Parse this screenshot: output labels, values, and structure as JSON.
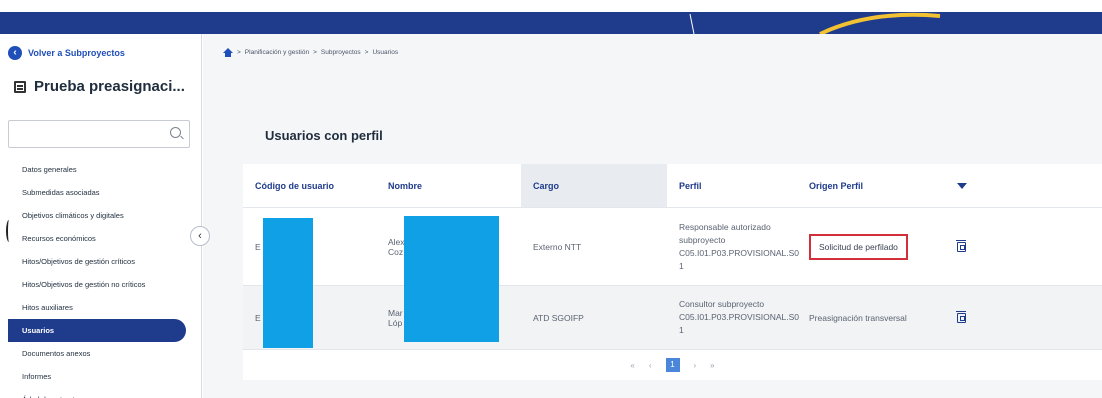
{
  "sidebar": {
    "back_label": "Volver a Subproyectos",
    "project_title": "Prueba preasignaci...",
    "search": {
      "placeholder": "",
      "value": ""
    },
    "items": [
      {
        "label": "Datos generales",
        "active": false
      },
      {
        "label": "Submedidas asociadas",
        "active": false
      },
      {
        "label": "Objetivos climáticos y digitales",
        "active": false
      },
      {
        "label": "Recursos económicos",
        "active": false
      },
      {
        "label": "Hitos/Objetivos de gestión críticos",
        "active": false
      },
      {
        "label": "Hitos/Objetivos de gestión no críticos",
        "active": false
      },
      {
        "label": "Hitos auxiliares",
        "active": false
      },
      {
        "label": "Usuarios",
        "active": true
      },
      {
        "label": "Documentos anexos",
        "active": false
      },
      {
        "label": "Informes",
        "active": false
      },
      {
        "label": "Árbol de estructura",
        "active": false
      }
    ],
    "collapse_icon": "‹"
  },
  "breadcrumb": {
    "sep": ">",
    "items": [
      "Planificación y gestión",
      "Subproyectos",
      "Usuarios"
    ]
  },
  "main": {
    "section_title": "Usuarios con perfil"
  },
  "table": {
    "headers": {
      "codigo": "Código de usuario",
      "nombre": "Nombre",
      "cargo": "Cargo",
      "perfil": "Perfil",
      "origen": "Origen Perfil"
    },
    "rows": [
      {
        "codigo": "E",
        "nombre_l1": "Alex",
        "nombre_l2": "Coz",
        "cargo": "Externo NTT",
        "perfil_l1": "Responsable autorizado",
        "perfil_l2": "subproyecto",
        "perfil_l3": "C05.I01.P03.PROVISIONAL.S0",
        "perfil_l4": "1",
        "origen": "Solicitud de perfilado"
      },
      {
        "codigo": "E",
        "nombre_l1": "Mar",
        "nombre_l2": "Lóp",
        "cargo": "ATD SGOIFP",
        "perfil_l1": "Consultor subproyecto",
        "perfil_l2": "C05.I01.P03.PROVISIONAL.S0",
        "perfil_l3": "1",
        "origen": "Preasignación transversal"
      }
    ]
  },
  "pagination": {
    "first": "«",
    "prev": "‹",
    "current": "1",
    "next": "›",
    "last": "»"
  },
  "colors": {
    "brand": "#1f3b8c",
    "link": "#1f4fb8",
    "redaction": "#0fa0e6",
    "highlight_border": "#d32f3a"
  }
}
